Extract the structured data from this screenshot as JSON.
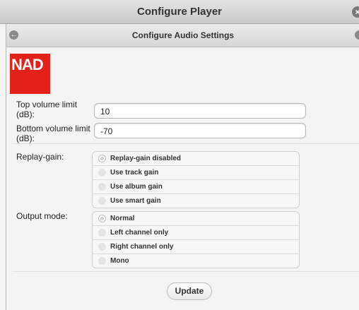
{
  "window": {
    "title": "Configure Player",
    "close_icon": "x-circle-icon"
  },
  "header": {
    "title": "Configure Audio Settings",
    "back_icon": "back-arrow-icon",
    "right_icon": "circle-icon"
  },
  "logo": {
    "text": "NAD",
    "color": "#e32119"
  },
  "fields": {
    "top_volume": {
      "label": "Top volume limit (dB):",
      "value": "10"
    },
    "bottom_volume": {
      "label": "Bottom volume limit (dB):",
      "value": "-70"
    }
  },
  "replay_gain": {
    "label": "Replay-gain:",
    "options": [
      "Replay-gain disabled",
      "Use track gain",
      "Use album gain",
      "Use smart gain"
    ],
    "selected": "Replay-gain disabled"
  },
  "output_mode": {
    "label": "Output mode:",
    "options": [
      "Normal",
      "Left channel only",
      "Right channel only",
      "Mono"
    ],
    "selected": "Normal"
  },
  "actions": {
    "update_label": "Update"
  }
}
